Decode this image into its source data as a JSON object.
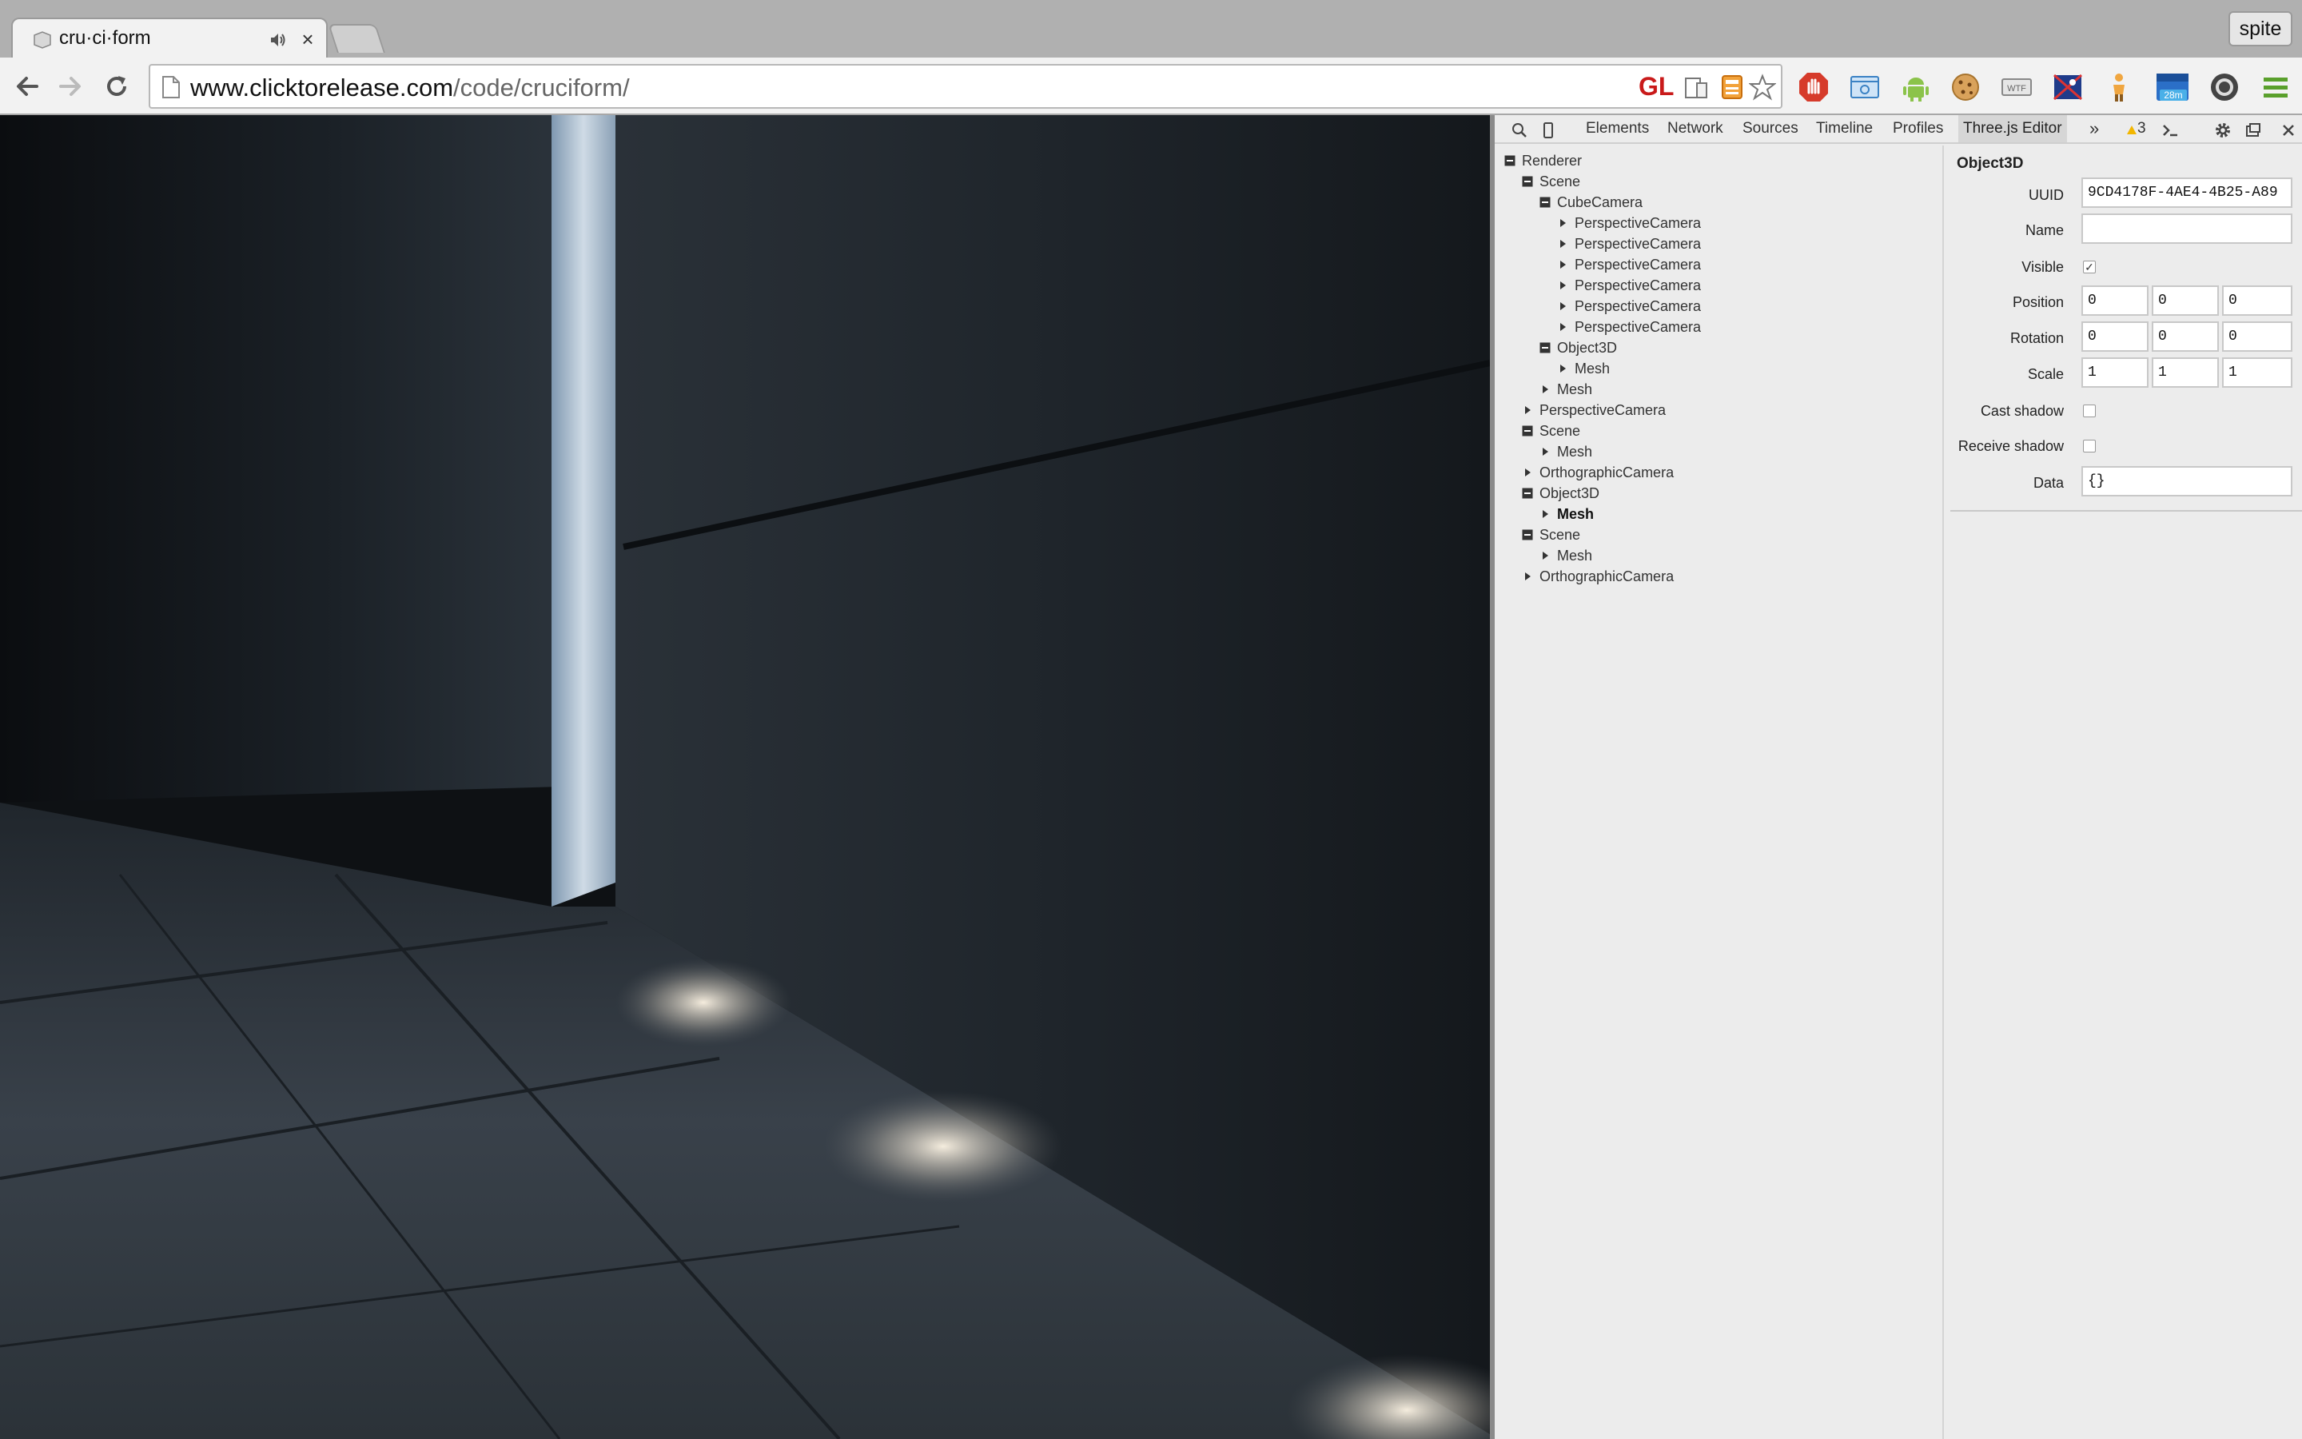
{
  "browser": {
    "tab_title": "cru·ci·form",
    "profile_name": "spite",
    "url_host": "www.clicktorelease.com",
    "url_path": "/code/cruciform/",
    "omnibox_gl_label": "GL",
    "extension_badge": "28m"
  },
  "devtools": {
    "tabs": [
      {
        "label": "Elements"
      },
      {
        "label": "Network"
      },
      {
        "label": "Sources"
      },
      {
        "label": "Timeline"
      },
      {
        "label": "Profiles"
      },
      {
        "label": "Three.js Editor"
      }
    ],
    "more_tabs_label": "»",
    "warning_count": "3",
    "tree": [
      {
        "label": "Renderer",
        "depth": 0,
        "state": "expanded"
      },
      {
        "label": "Scene",
        "depth": 1,
        "state": "expanded"
      },
      {
        "label": "CubeCamera",
        "depth": 2,
        "state": "expanded"
      },
      {
        "label": "PerspectiveCamera",
        "depth": 3,
        "state": "collapsed"
      },
      {
        "label": "PerspectiveCamera",
        "depth": 3,
        "state": "collapsed"
      },
      {
        "label": "PerspectiveCamera",
        "depth": 3,
        "state": "collapsed"
      },
      {
        "label": "PerspectiveCamera",
        "depth": 3,
        "state": "collapsed"
      },
      {
        "label": "PerspectiveCamera",
        "depth": 3,
        "state": "collapsed"
      },
      {
        "label": "PerspectiveCamera",
        "depth": 3,
        "state": "collapsed"
      },
      {
        "label": "Object3D",
        "depth": 2,
        "state": "expanded"
      },
      {
        "label": "Mesh",
        "depth": 3,
        "state": "collapsed"
      },
      {
        "label": "Mesh",
        "depth": 2,
        "state": "collapsed"
      },
      {
        "label": "PerspectiveCamera",
        "depth": 1,
        "state": "collapsed"
      },
      {
        "label": "Scene",
        "depth": 1,
        "state": "expanded"
      },
      {
        "label": "Mesh",
        "depth": 2,
        "state": "collapsed"
      },
      {
        "label": "OrthographicCamera",
        "depth": 1,
        "state": "collapsed"
      },
      {
        "label": "Object3D",
        "depth": 1,
        "state": "expanded"
      },
      {
        "label": "Mesh",
        "depth": 2,
        "state": "collapsed",
        "selected": true
      },
      {
        "label": "Scene",
        "depth": 1,
        "state": "expanded"
      },
      {
        "label": "Mesh",
        "depth": 2,
        "state": "collapsed"
      },
      {
        "label": "OrthographicCamera",
        "depth": 1,
        "state": "collapsed"
      }
    ],
    "inspector": {
      "title": "Object3D",
      "uuid_label": "UUID",
      "uuid_value": "9CD4178F-4AE4-4B25-A89",
      "name_label": "Name",
      "name_value": "",
      "visible_label": "Visible",
      "visible_checked": true,
      "position_label": "Position",
      "position": [
        "0",
        "0",
        "0"
      ],
      "rotation_label": "Rotation",
      "rotation": [
        "0",
        "0",
        "0"
      ],
      "scale_label": "Scale",
      "scale": [
        "1",
        "1",
        "1"
      ],
      "cast_shadow_label": "Cast shadow",
      "cast_shadow_checked": false,
      "receive_shadow_label": "Receive shadow",
      "receive_shadow_checked": false,
      "data_label": "Data",
      "data_value": "{}"
    }
  }
}
